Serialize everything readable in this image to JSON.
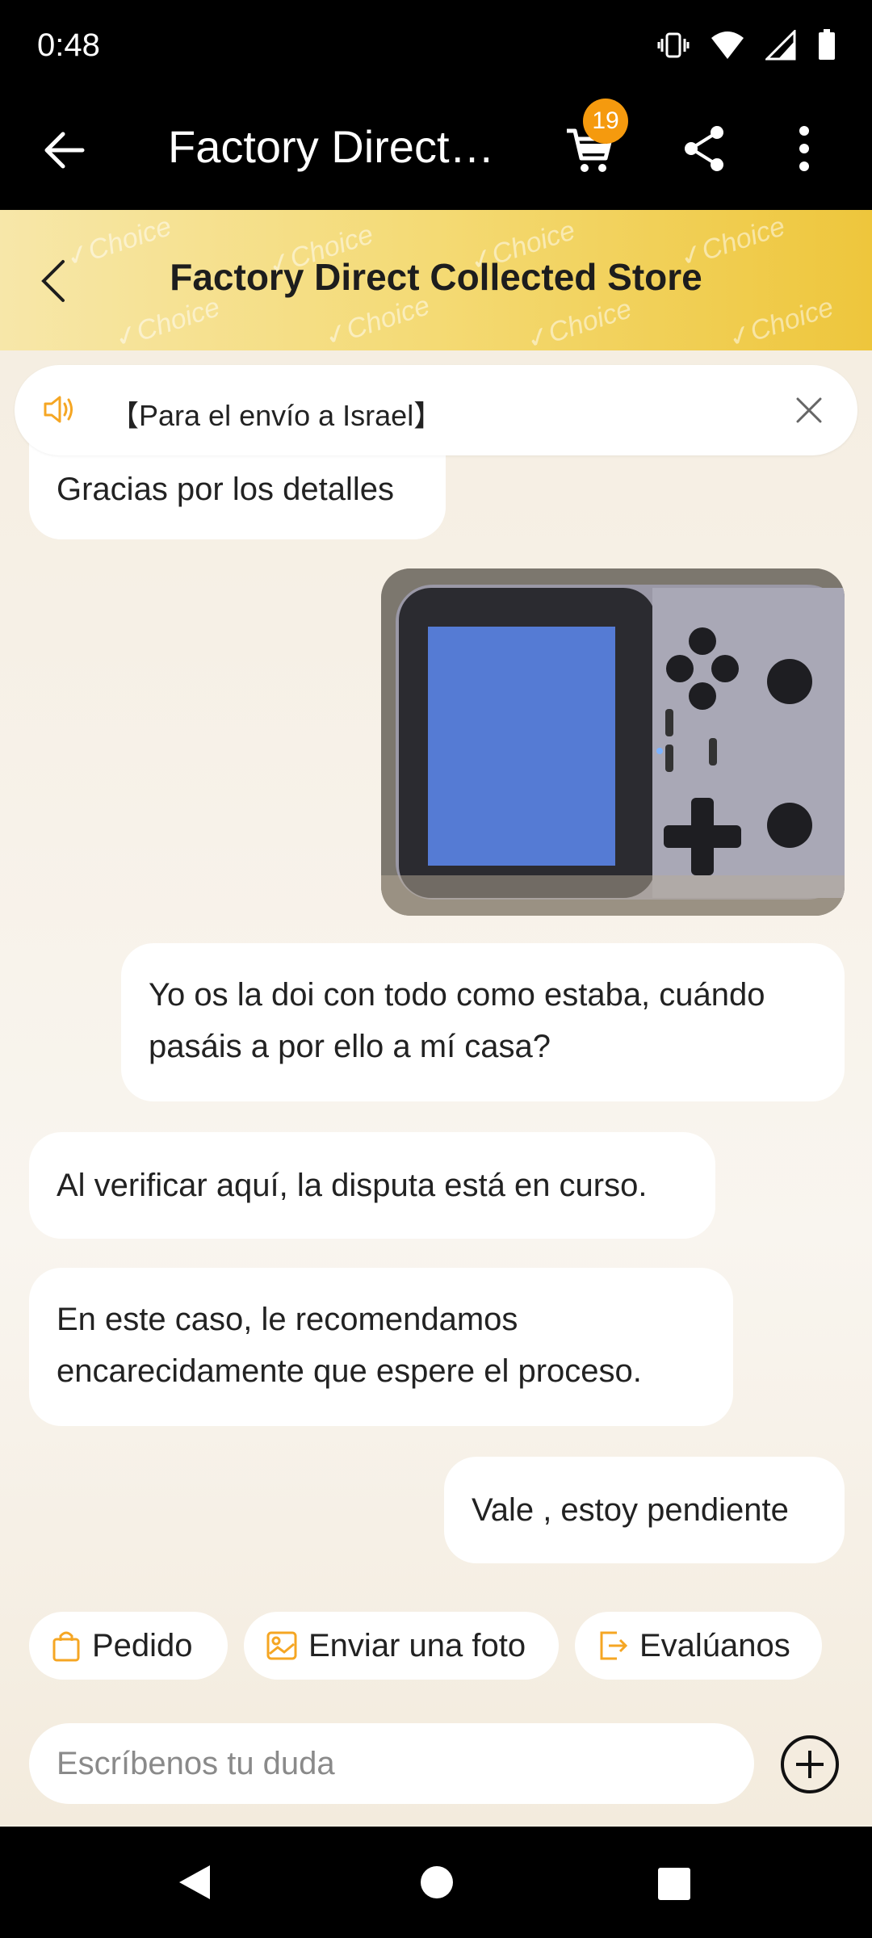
{
  "status": {
    "time": "0:48"
  },
  "app_bar": {
    "title": "Factory Direct…",
    "cart_count": "19"
  },
  "store": {
    "name": "Factory Direct Collected Store",
    "watermark": "✓Choice"
  },
  "notice": {
    "text": "【Para el envío a Israel】"
  },
  "messages": [
    {
      "side": "left",
      "text": "Gracias por los detalles"
    },
    {
      "side": "right",
      "type": "image",
      "alt": ""
    },
    {
      "side": "right",
      "text": "Yo os la doi con todo como estaba, cuándo pasáis a por ello a mí casa?"
    },
    {
      "side": "left",
      "text": "Al verificar aquí, la disputa está en curso."
    },
    {
      "side": "left",
      "text": "En este caso, le recomendamos encarecidamente que espere el proceso."
    },
    {
      "side": "right",
      "text": "Vale , estoy pendiente"
    }
  ],
  "quick_actions": [
    {
      "label": "Pedido",
      "icon": "bag-icon"
    },
    {
      "label": "Enviar una foto",
      "icon": "image-icon"
    },
    {
      "label": "Evalúanos",
      "icon": "rate-icon"
    }
  ],
  "composer": {
    "placeholder": "Escríbenos tu duda"
  },
  "colors": {
    "accent": "#f59a0e",
    "header_gold": "#eec63c",
    "bar": "#000000"
  }
}
